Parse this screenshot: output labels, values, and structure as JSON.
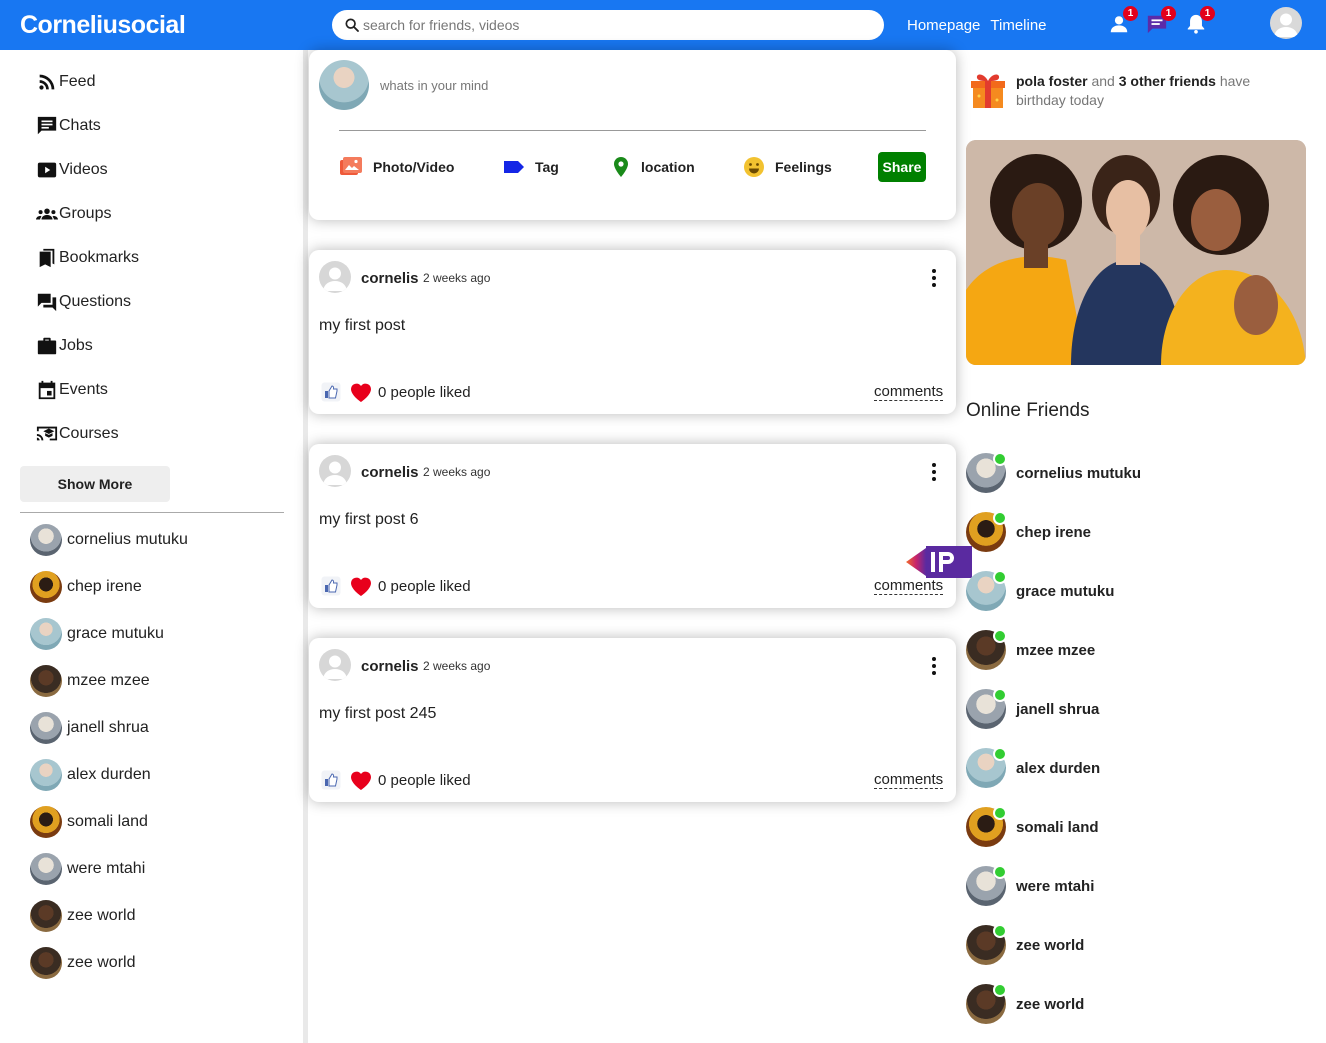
{
  "header": {
    "logo": "Corneliusocial",
    "search_placeholder": "search for friends, videos",
    "links": [
      "Homepage",
      "Timeline"
    ],
    "badges": {
      "friends": "1",
      "messages": "1",
      "notifications": "1"
    }
  },
  "sidebar": {
    "items": [
      {
        "label": "Feed",
        "icon": "rss-feed-icon"
      },
      {
        "label": "Chats",
        "icon": "chat-icon"
      },
      {
        "label": "Videos",
        "icon": "play-video-icon"
      },
      {
        "label": "Groups",
        "icon": "groups-icon"
      },
      {
        "label": "Bookmarks",
        "icon": "bookmarks-icon"
      },
      {
        "label": "Questions",
        "icon": "questions-icon"
      },
      {
        "label": "Jobs",
        "icon": "briefcase-icon"
      },
      {
        "label": "Events",
        "icon": "calendar-icon"
      },
      {
        "label": "Courses",
        "icon": "courses-icon"
      }
    ],
    "show_more": "Show More",
    "friends": [
      "cornelius mutuku",
      "chep irene",
      "grace mutuku",
      "mzee mzee",
      "janell shrua",
      "alex durden",
      "somali land",
      "were mtahi",
      "zee world",
      "zee world"
    ]
  },
  "share": {
    "placeholder": "whats in your mind",
    "options": [
      "Photo/Video",
      "Tag",
      "location",
      "Feelings"
    ],
    "share_button": "Share"
  },
  "posts": [
    {
      "author": "cornelis",
      "time": "2 weeks ago",
      "text": "my first post",
      "likes": "0 people liked",
      "comments": "comments"
    },
    {
      "author": "cornelis",
      "time": "2 weeks ago",
      "text": "my first post 6",
      "likes": "0 people liked",
      "comments": "comments"
    },
    {
      "author": "cornelis",
      "time": "2 weeks ago",
      "text": "my first post 245",
      "likes": "0 people liked",
      "comments": "comments"
    }
  ],
  "rightbar": {
    "birthday": {
      "name": "pola foster",
      "and": "and",
      "others": "3 other friends",
      "suffix": "have birthday today"
    },
    "online_title": "Online Friends",
    "online_friends": [
      "cornelius mutuku",
      "chep irene",
      "grace mutuku",
      "mzee mzee",
      "janell shrua",
      "alex durden",
      "somali land",
      "were mtahi",
      "zee world",
      "zee world"
    ]
  },
  "colors": {
    "brand": "#1877f2",
    "share": "#008000",
    "online": "#32cd32",
    "badge": "#e3001b"
  }
}
